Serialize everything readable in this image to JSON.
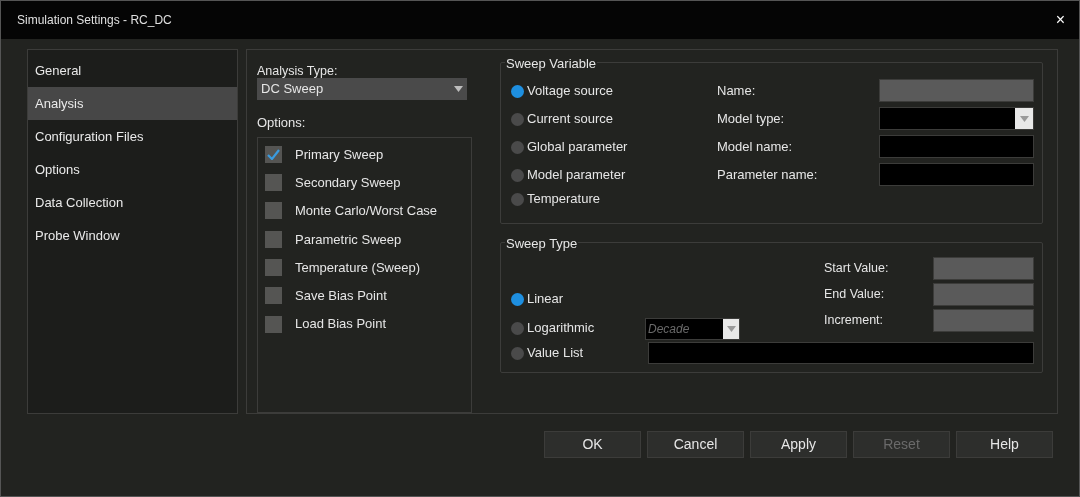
{
  "window": {
    "title": "Simulation Settings - RC_DC",
    "close": "×"
  },
  "sidebar": {
    "items": [
      {
        "label": "General",
        "selected": false
      },
      {
        "label": "Analysis",
        "selected": true
      },
      {
        "label": "Configuration Files",
        "selected": false
      },
      {
        "label": "Options",
        "selected": false
      },
      {
        "label": "Data Collection",
        "selected": false
      },
      {
        "label": "Probe Window",
        "selected": false
      }
    ]
  },
  "analysis_type": {
    "label": "Analysis Type:",
    "value": "DC Sweep"
  },
  "options": {
    "label": "Options:",
    "items": [
      {
        "label": "Primary Sweep",
        "checked": true
      },
      {
        "label": "Secondary Sweep",
        "checked": false
      },
      {
        "label": "Monte Carlo/Worst Case",
        "checked": false
      },
      {
        "label": "Parametric Sweep",
        "checked": false
      },
      {
        "label": "Temperature (Sweep)",
        "checked": false
      },
      {
        "label": "Save Bias Point",
        "checked": false
      },
      {
        "label": "Load Bias Point",
        "checked": false
      }
    ]
  },
  "sweep_variable": {
    "title": "Sweep Variable",
    "radios": [
      {
        "label": "Voltage source",
        "selected": true
      },
      {
        "label": "Current source",
        "selected": false
      },
      {
        "label": "Global parameter",
        "selected": false
      },
      {
        "label": "Model parameter",
        "selected": false
      },
      {
        "label": "Temperature",
        "selected": false
      }
    ],
    "fields": [
      {
        "label": "Name:",
        "kind": "text",
        "disabled": true
      },
      {
        "label": "Model type:",
        "kind": "dropdown",
        "disabled": false
      },
      {
        "label": "Model name:",
        "kind": "text",
        "disabled": false
      },
      {
        "label": "Parameter name:",
        "kind": "text",
        "disabled": false
      }
    ]
  },
  "sweep_type": {
    "title": "Sweep Type",
    "radios": [
      {
        "label": "Linear",
        "selected": true
      },
      {
        "label": "Logarithmic",
        "selected": false
      },
      {
        "label": "Value List",
        "selected": false
      }
    ],
    "log_scale": {
      "value": "Decade",
      "disabled": true
    },
    "fields": [
      {
        "label": "Start Value:",
        "disabled": true
      },
      {
        "label": "End Value:",
        "disabled": true
      },
      {
        "label": "Increment:",
        "disabled": true
      }
    ]
  },
  "buttons": [
    {
      "label": "OK",
      "disabled": false
    },
    {
      "label": "Cancel",
      "disabled": false
    },
    {
      "label": "Apply",
      "disabled": false
    },
    {
      "label": "Reset",
      "disabled": true
    },
    {
      "label": "Help",
      "disabled": false
    }
  ]
}
